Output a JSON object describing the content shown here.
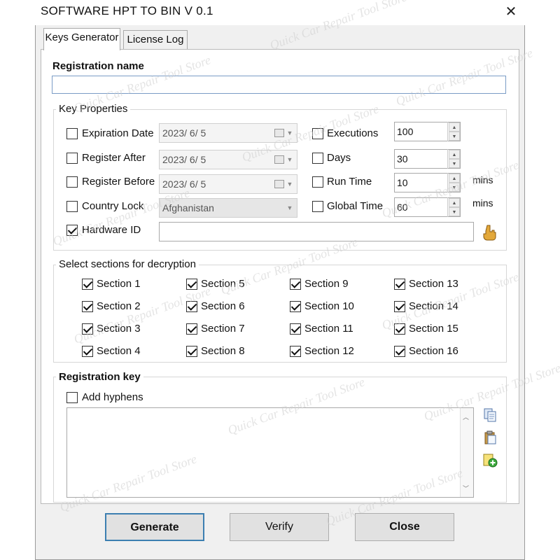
{
  "window": {
    "title": "SOFTWARE HPT TO BIN  V 0.1",
    "close_glyph": "✕"
  },
  "tabs": [
    {
      "label": "Keys Generator",
      "active": true
    },
    {
      "label": "License Log",
      "active": false
    }
  ],
  "registration_name": {
    "label": "Registration name",
    "value": ""
  },
  "key_properties": {
    "legend": "Key Properties",
    "expiration_date": {
      "label": "Expiration Date",
      "checked": false,
      "value": "2023/ 6/ 5"
    },
    "register_after": {
      "label": "Register After",
      "checked": false,
      "value": "2023/ 6/ 5"
    },
    "register_before": {
      "label": "Register Before",
      "checked": false,
      "value": "2023/ 6/ 5"
    },
    "country_lock": {
      "label": "Country Lock",
      "checked": false,
      "value": "Afghanistan"
    },
    "hardware_id": {
      "label": "Hardware ID",
      "checked": true,
      "value": ""
    },
    "executions": {
      "label": "Executions",
      "checked": false,
      "value": "100"
    },
    "days": {
      "label": "Days",
      "checked": false,
      "value": "30"
    },
    "run_time": {
      "label": "Run Time",
      "checked": false,
      "value": "10",
      "unit": "mins"
    },
    "global_time": {
      "label": "Global Time",
      "checked": false,
      "value": "60",
      "unit": "mins"
    }
  },
  "sections": {
    "legend": "Select sections for decryption",
    "items": [
      {
        "label": "Section 1",
        "checked": true
      },
      {
        "label": "Section 2",
        "checked": true
      },
      {
        "label": "Section 3",
        "checked": true
      },
      {
        "label": "Section 4",
        "checked": true
      },
      {
        "label": "Section 5",
        "checked": true
      },
      {
        "label": "Section 6",
        "checked": true
      },
      {
        "label": "Section 7",
        "checked": true
      },
      {
        "label": "Section 8",
        "checked": true
      },
      {
        "label": "Section 9",
        "checked": true
      },
      {
        "label": "Section 10",
        "checked": true
      },
      {
        "label": "Section 11",
        "checked": true
      },
      {
        "label": "Section 12",
        "checked": true
      },
      {
        "label": "Section 13",
        "checked": true
      },
      {
        "label": "Section 14",
        "checked": true
      },
      {
        "label": "Section 15",
        "checked": true
      },
      {
        "label": "Section 16",
        "checked": true
      }
    ]
  },
  "registration_key": {
    "legend": "Registration key",
    "add_hyphens_label": "Add hyphens",
    "add_hyphens_checked": false,
    "value": ""
  },
  "buttons": {
    "generate": "Generate",
    "verify": "Verify",
    "close": "Close"
  },
  "watermark": "Quick Car Repair Tool Store"
}
